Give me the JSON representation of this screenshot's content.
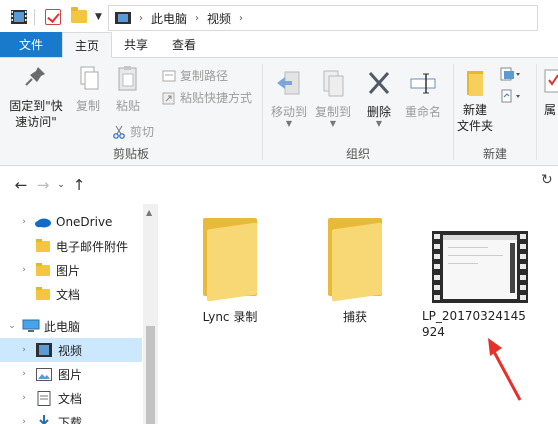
{
  "window": {
    "title": "视频"
  },
  "tabs": [
    {
      "label": "文件",
      "kind": "file"
    },
    {
      "label": "主页",
      "kind": "active"
    },
    {
      "label": "共享",
      "kind": ""
    },
    {
      "label": "查看",
      "kind": ""
    }
  ],
  "ribbon": {
    "clipboard": {
      "label": "剪贴板",
      "pin_line1": "固定到\"快",
      "pin_line2": "速访问\"",
      "copy": "复制",
      "paste": "粘贴",
      "copy_path": "复制路径",
      "paste_shortcut": "粘贴快捷方式",
      "cut": "剪切"
    },
    "organize": {
      "label": "组织",
      "move_to": "移动到",
      "copy_to": "复制到",
      "delete": "删除",
      "rename": "重命名"
    },
    "new": {
      "label": "新建",
      "new_folder_line1": "新建",
      "new_folder_line2": "文件夹"
    },
    "properties": {
      "label": "属"
    }
  },
  "breadcrumb": [
    "此电脑",
    "视频"
  ],
  "navpane": [
    {
      "label": "OneDrive",
      "icon": "cloud-icon",
      "expander": "collapsed",
      "indent": 1,
      "selected": false
    },
    {
      "label": "电子邮件附件",
      "icon": "folder-icon",
      "expander": "",
      "indent": 2,
      "selected": false
    },
    {
      "label": "图片",
      "icon": "folder-icon",
      "expander": "collapsed",
      "indent": 2,
      "selected": false
    },
    {
      "label": "文档",
      "icon": "folder-icon",
      "expander": "",
      "indent": 2,
      "selected": false
    },
    {
      "label": "此电脑",
      "icon": "computer-icon",
      "expander": "expanded",
      "indent": 1,
      "selected": false
    },
    {
      "label": "视频",
      "icon": "video-icon",
      "expander": "collapsed",
      "indent": 2,
      "selected": true
    },
    {
      "label": "图片",
      "icon": "picture-icon",
      "expander": "collapsed",
      "indent": 2,
      "selected": false
    },
    {
      "label": "文档",
      "icon": "document-icon",
      "expander": "collapsed",
      "indent": 2,
      "selected": false
    },
    {
      "label": "下载",
      "icon": "download-icon",
      "expander": "collapsed",
      "indent": 2,
      "selected": false
    }
  ],
  "content": {
    "items": [
      {
        "name": "Lync 录制",
        "type": "folder"
      },
      {
        "name": "捕获",
        "type": "folder"
      },
      {
        "name_line1": "LP_20170324145",
        "name_line2": "924",
        "type": "video"
      }
    ]
  },
  "colors": {
    "accent": "#1979ca",
    "selection": "#cce8ff",
    "folder": "#f3c63f",
    "annotation_arrow": "#e8302a"
  }
}
